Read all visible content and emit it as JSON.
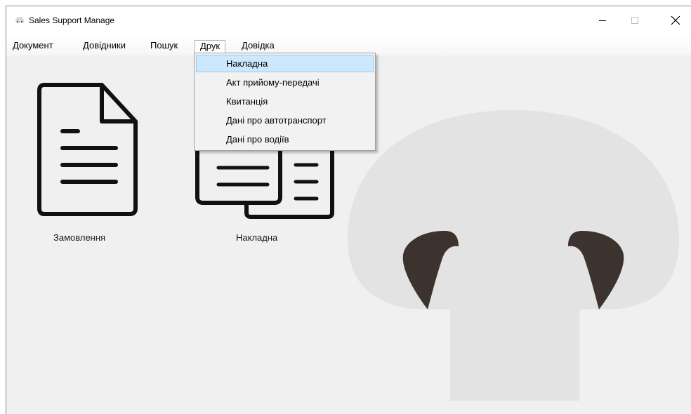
{
  "window": {
    "title": "Sales Support Manage"
  },
  "menubar": [
    {
      "label": "Документ"
    },
    {
      "label": "Довідники"
    },
    {
      "label": "Пошук"
    },
    {
      "label": "Друк"
    },
    {
      "label": "Довідка"
    }
  ],
  "dropdown": {
    "items": [
      {
        "label": "Накладна"
      },
      {
        "label": "Акт прийому-передачі"
      },
      {
        "label": "Квитанція"
      },
      {
        "label": "Дані про автотранспорт"
      },
      {
        "label": "Дані про водіїв"
      }
    ]
  },
  "desktop": {
    "icons": [
      {
        "label": "Замовлення",
        "icon": "document-icon"
      },
      {
        "label": "Накладна",
        "icon": "documents-icon"
      }
    ]
  },
  "colors": {
    "menu_highlight": "#cce8ff",
    "watermark": "#e3e3e3",
    "watermark_accent": "#3d332e"
  }
}
